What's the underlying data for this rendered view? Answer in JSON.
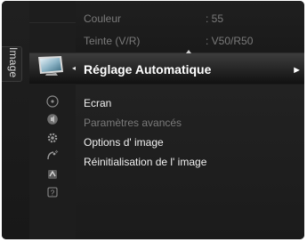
{
  "sidebar": {
    "label": "Image"
  },
  "settings": {
    "couleur": {
      "label": "Couleur",
      "value": ": 55"
    },
    "teinte": {
      "label": "Teinte (V/R)",
      "value": ": V50/R50"
    }
  },
  "menu": {
    "selected": {
      "label": "Réglage Automatique",
      "arrow": "►"
    },
    "items": [
      {
        "label": "Ecran",
        "enabled": true
      },
      {
        "label": "Paramètres avancés",
        "enabled": false
      },
      {
        "label": "Options d' image",
        "enabled": true
      },
      {
        "label": "Réinitialisation de l' image",
        "enabled": true
      }
    ]
  },
  "icons": [
    "tv-picture-icon",
    "disc-icon",
    "speaker-icon",
    "gear-icon",
    "satellite-icon",
    "input-icon",
    "help-icon"
  ],
  "colors": {
    "panel_bg": "#1a1a1a",
    "highlight": "#3d3d3d",
    "text_primary": "#f0f0f0",
    "text_dim": "#7a7a7a"
  }
}
